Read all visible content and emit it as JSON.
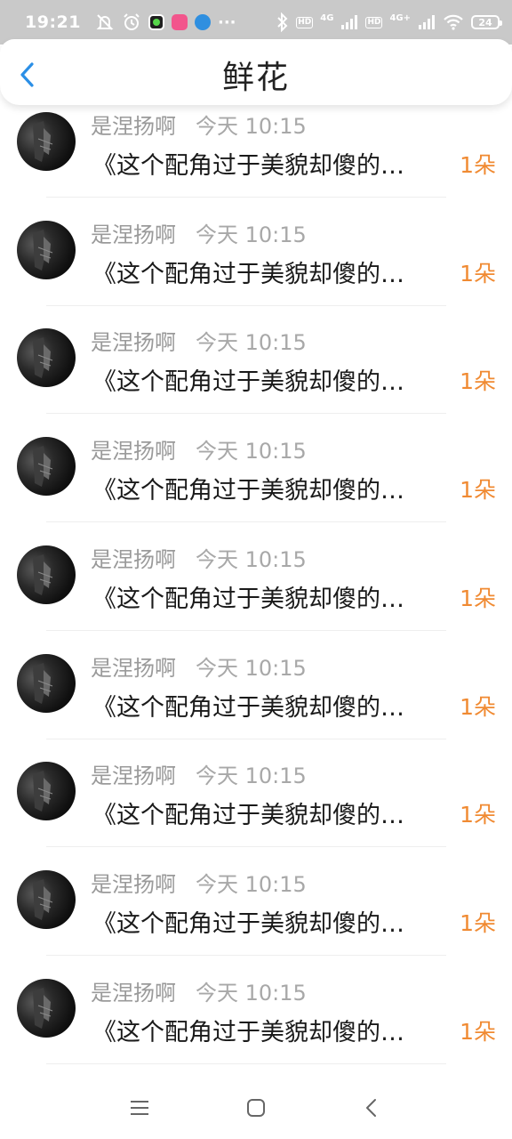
{
  "status_bar": {
    "time": "19:21",
    "battery": "24",
    "net_label_1": "4G",
    "net_label_2": "4G+",
    "hd_label": "HD",
    "icons": [
      "mute-icon",
      "alarm-icon",
      "app-green-icon",
      "app-pink-icon",
      "app-blue-icon",
      "more-dots-icon",
      "bluetooth-icon",
      "hd-icon",
      "signal-icon",
      "hd-icon",
      "signal-icon",
      "wifi-icon",
      "battery-icon"
    ]
  },
  "header": {
    "title": "鲜花",
    "back_icon": "chevron-left-icon"
  },
  "colors": {
    "accent_blue": "#2b8fe6",
    "count_orange": "#f08a32",
    "name_gray": "#9a9a9a"
  },
  "items": [
    {
      "name": "是涅扬啊",
      "time": "今天 10:15",
      "message": "《这个配角过于美貌却傻的…",
      "count": "1朵"
    },
    {
      "name": "是涅扬啊",
      "time": "今天 10:15",
      "message": "《这个配角过于美貌却傻的…",
      "count": "1朵"
    },
    {
      "name": "是涅扬啊",
      "time": "今天 10:15",
      "message": "《这个配角过于美貌却傻的…",
      "count": "1朵"
    },
    {
      "name": "是涅扬啊",
      "time": "今天 10:15",
      "message": "《这个配角过于美貌却傻的…",
      "count": "1朵"
    },
    {
      "name": "是涅扬啊",
      "time": "今天 10:15",
      "message": "《这个配角过于美貌却傻的…",
      "count": "1朵"
    },
    {
      "name": "是涅扬啊",
      "time": "今天 10:15",
      "message": "《这个配角过于美貌却傻的…",
      "count": "1朵"
    },
    {
      "name": "是涅扬啊",
      "time": "今天 10:15",
      "message": "《这个配角过于美貌却傻的…",
      "count": "1朵"
    },
    {
      "name": "是涅扬啊",
      "time": "今天 10:15",
      "message": "《这个配角过于美貌却傻的…",
      "count": "1朵"
    },
    {
      "name": "是涅扬啊",
      "time": "今天 10:15",
      "message": "《这个配角过于美貌却傻的…",
      "count": "1朵"
    }
  ],
  "nav_bar": {
    "icons": [
      "menu-icon",
      "home-icon",
      "back-icon"
    ]
  }
}
